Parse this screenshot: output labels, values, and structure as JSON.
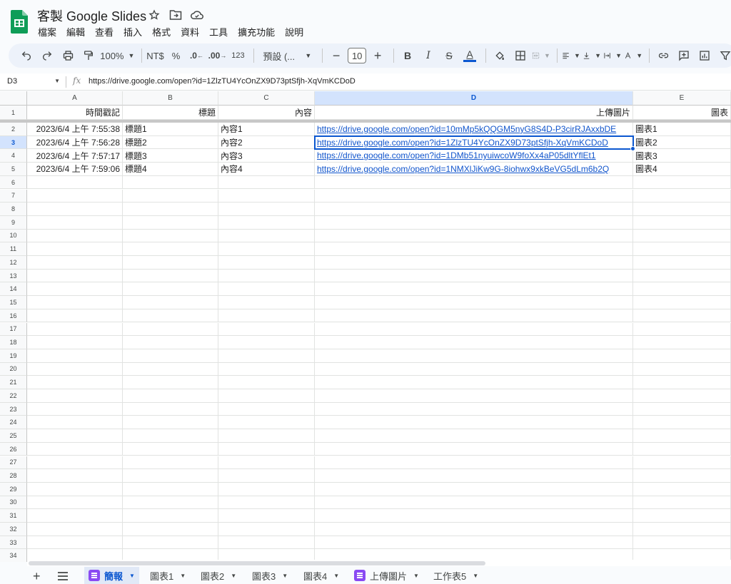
{
  "app": {
    "title": "客製 Google Slides",
    "menu": [
      "檔案",
      "編輯",
      "查看",
      "插入",
      "格式",
      "資料",
      "工具",
      "擴充功能",
      "說明"
    ]
  },
  "toolbar": {
    "zoom": "100%",
    "currency": "NT$",
    "percent": "%",
    "dec_decrease": ".0",
    "dec_increase": ".00",
    "number_format": "123",
    "font": "預設 (...",
    "font_size": "10",
    "bold": "B",
    "italic": "I",
    "text_color": "A"
  },
  "formula_bar": {
    "cell_ref": "D3",
    "fx": "fx",
    "value": "https://drive.google.com/open?id=1ZlzTU4YcOnZX9D73ptSfjh-XqVmKCDoD"
  },
  "columns": [
    "A",
    "B",
    "C",
    "D",
    "E"
  ],
  "selected_column": "D",
  "header_row": [
    "時間戳記",
    "標題",
    "內容",
    "上傳圖片",
    "圖表"
  ],
  "rows": [
    [
      "2023/6/4 上午 7:55:38",
      "標題1",
      "內容1",
      "https://drive.google.com/open?id=10mMp5kQQGM5nyG8S4D-P3cirRJAxxbDE",
      "圖表1"
    ],
    [
      "2023/6/4 上午 7:56:28",
      "標題2",
      "內容2",
      "https://drive.google.com/open?id=1ZlzTU4YcOnZX9D73ptSfjh-XqVmKCDoD",
      "圖表2"
    ],
    [
      "2023/6/4 上午 7:57:17",
      "標題3",
      "內容3",
      "https://drive.google.com/open?id=1DMb51nyuiwcoW9foXx4aP05dltYflEt1",
      "圖表3"
    ],
    [
      "2023/6/4 上午 7:59:06",
      "標題4",
      "內容4",
      "https://drive.google.com/open?id=1NMXlJiKw9G-8iohwx9xkBeVG5dLm6b2Q",
      "圖表4"
    ]
  ],
  "row_numbers": [
    "1",
    "2",
    "3",
    "4",
    "5",
    "6",
    "7",
    "8",
    "9",
    "10",
    "11",
    "12",
    "13",
    "14",
    "15",
    "16",
    "17",
    "18",
    "19",
    "20",
    "21",
    "22",
    "23",
    "24",
    "25",
    "26",
    "27",
    "28",
    "29",
    "30",
    "31",
    "32",
    "33",
    "34"
  ],
  "selected_row": "3",
  "sheet_tabs": [
    {
      "label": "簡報",
      "active": true,
      "icon": "form-icon"
    },
    {
      "label": "圖表1",
      "active": false
    },
    {
      "label": "圖表2",
      "active": false
    },
    {
      "label": "圖表3",
      "active": false
    },
    {
      "label": "圖表4",
      "active": false
    },
    {
      "label": "上傳圖片",
      "active": false,
      "icon": "form-icon"
    },
    {
      "label": "工作表5",
      "active": false
    }
  ],
  "colors": {
    "accent": "#0b57d0",
    "link": "#1155cc",
    "sheets_green": "#0f9d58",
    "form_purple": "#8a4af3"
  }
}
